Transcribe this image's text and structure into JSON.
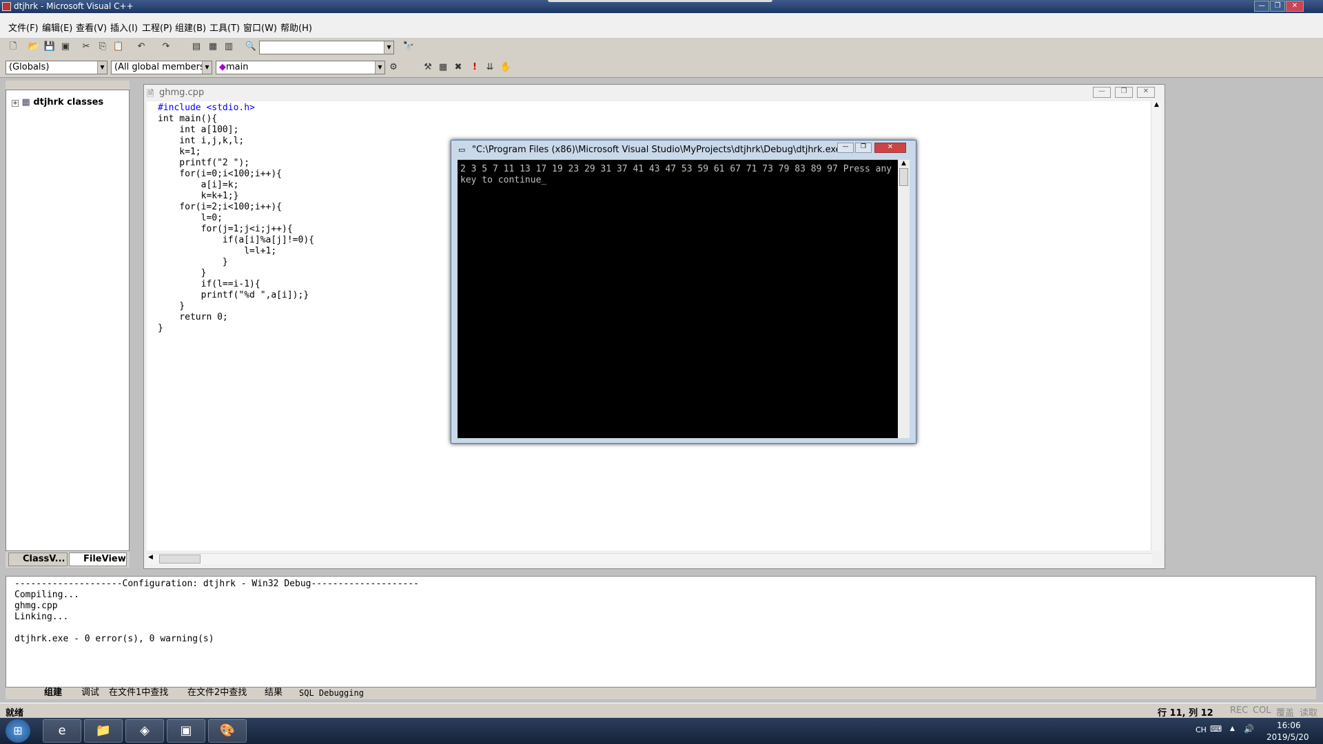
{
  "app": {
    "title": "dtjhrk - Microsoft Visual C++"
  },
  "menu": [
    "文件(F)",
    "编辑(E)",
    "查看(V)",
    "插入(I)",
    "工程(P)",
    "组建(B)",
    "工具(T)",
    "窗口(W)",
    "帮助(H)"
  ],
  "toolbar": {
    "scope_combo": "(Globals)",
    "members_combo": "(All global members",
    "function_combo": "main"
  },
  "workspace": {
    "tree_root": "dtjhrk classes",
    "tabs": [
      "ClassV...",
      "FileView"
    ]
  },
  "editor": {
    "tab_title": "ghmg.cpp",
    "lines": [
      "#include <stdio.h>",
      "int main(){",
      "    int a[100];",
      "    int i,j,k,l;",
      "    k=1;",
      "    printf(\"2 \");",
      "    for(i=0;i<100;i++){",
      "        a[i]=k;",
      "        k=k+1;}",
      "    for(i=2;i<100;i++){",
      "        l=0;",
      "        for(j=1;j<i;j++){",
      "            if(a[i]%a[j]!=0){",
      "                l=l+1;",
      "            }",
      "        }",
      "        if(l==i-1){",
      "        printf(\"%d \",a[i]);}",
      "    }",
      "    return 0;",
      "}"
    ]
  },
  "console": {
    "title": "\"C:\\Program Files (x86)\\Microsoft Visual Studio\\MyProjects\\dtjhrk\\Debug\\dtjhrk.exe\"",
    "output": "2 3 5 7 11 13 17 19 23 29 31 37 41 43 47 53 59 61 67 71 73 79 83 89 97 Press any key to continue"
  },
  "output_pane": {
    "lines": [
      "--------------------Configuration: dtjhrk - Win32 Debug--------------------",
      "Compiling...",
      "ghmg.cpp",
      "Linking...",
      "",
      "dtjhrk.exe - 0 error(s), 0 warning(s)"
    ],
    "tabs": [
      "组建",
      "调试",
      "在文件1中查找",
      "在文件2中查找",
      "结果",
      "SQL Debugging"
    ]
  },
  "status": {
    "left": "就绪",
    "position": "行 11, 列 12",
    "indicators": [
      "REC",
      "COL",
      "覆盖",
      "读取"
    ]
  },
  "taskbar": {
    "ime": "CH",
    "time": "16:06",
    "date": "2019/5/20"
  }
}
